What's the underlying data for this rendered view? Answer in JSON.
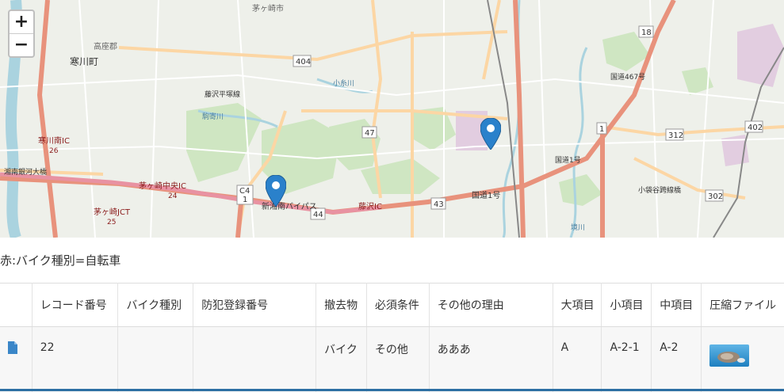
{
  "map": {
    "zoom_in_label": "+",
    "zoom_out_label": "−",
    "place_labels": [
      "寒川町",
      "高座郡",
      "茅ヶ崎市",
      "寒川南IC",
      "26",
      "茅ヶ崎中央IC",
      "24",
      "茅ヶ崎JCT",
      "25",
      "湘南銀河大橋",
      "C4",
      "1",
      "新湘南バイパス",
      "44",
      "藤沢IC",
      "43",
      "国道1号",
      "47",
      "404",
      "藤沢平塚線",
      "駒寄川",
      "小糸川",
      "18",
      "312",
      "402",
      "302",
      "国道1号",
      "小袋谷跨線橋",
      "国道467号",
      "境川"
    ],
    "colors": {
      "land": "#eef0ea",
      "park": "#cfe6c2",
      "river": "#aad3df",
      "major_road": "#e8927c",
      "secondary_road": "#fcd6a4",
      "marker": "#2a81cb"
    }
  },
  "legend_text": "赤:バイク種別=自転車",
  "table": {
    "headers": [
      "",
      "レコード番号",
      "バイク種別",
      "防犯登録番号",
      "撤去物",
      "必須条件",
      "その他の理由",
      "大項目",
      "小項目",
      "中項目",
      "圧縮ファイル"
    ],
    "rows": [
      {
        "icon": "document-icon",
        "record_no": "22",
        "bike_type": "",
        "registration_no": "",
        "removed_item": "バイク",
        "required_condition": "その他",
        "other_reason": "あああ",
        "major_item": "A",
        "minor_item": "A-2-1",
        "middle_item": "A-2",
        "compressed_file": "thumbnail-image"
      }
    ]
  }
}
